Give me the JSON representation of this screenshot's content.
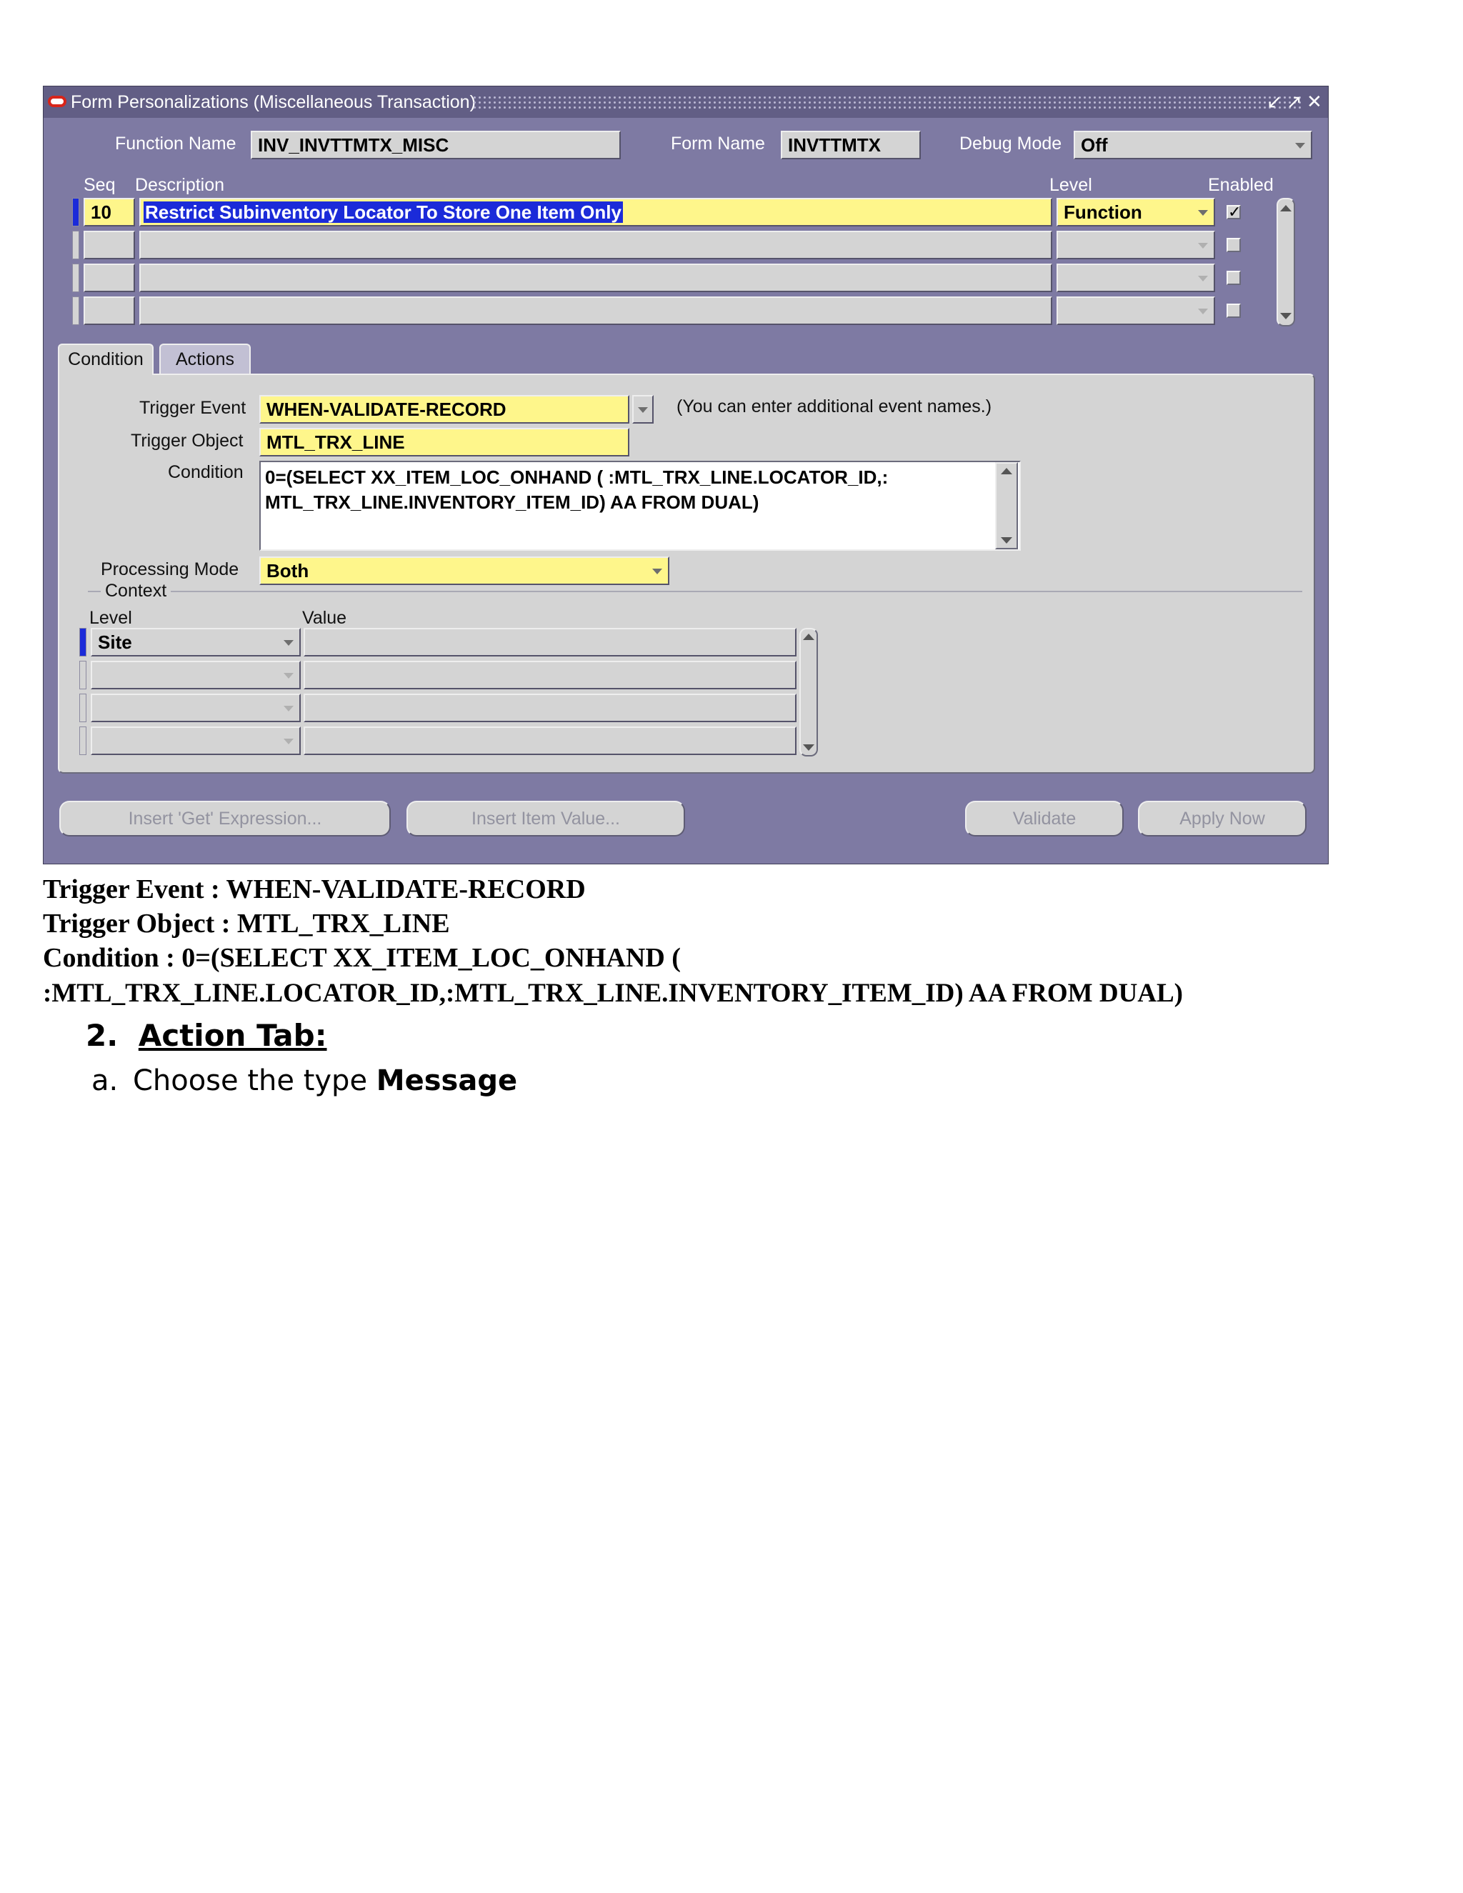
{
  "window": {
    "title": "Form Personalizations (Miscellaneous Transaction)",
    "controls": [
      "↙",
      "↗",
      "✕"
    ]
  },
  "header": {
    "function_name_label": "Function Name",
    "function_name_value": "INV_INVTTMTX_MISC",
    "form_name_label": "Form Name",
    "form_name_value": "INVTTMTX",
    "debug_mode_label": "Debug Mode",
    "debug_mode_value": "Off"
  },
  "rules_grid": {
    "headers": {
      "seq": "Seq",
      "description": "Description",
      "level": "Level",
      "enabled": "Enabled"
    },
    "rows": [
      {
        "seq": "10",
        "description": "Restrict Subinventory Locator To Store One Item Only",
        "level": "Function",
        "enabled": true
      },
      {
        "seq": "",
        "description": "",
        "level": "",
        "enabled": false
      },
      {
        "seq": "",
        "description": "",
        "level": "",
        "enabled": false
      },
      {
        "seq": "",
        "description": "",
        "level": "",
        "enabled": false
      }
    ]
  },
  "tabs": [
    {
      "label": "Condition",
      "active": true
    },
    {
      "label": "Actions",
      "active": false
    }
  ],
  "condition_tab": {
    "trigger_event_label": "Trigger Event",
    "trigger_event_value": "WHEN-VALIDATE-RECORD",
    "trigger_event_hint": "(You can enter additional event names.)",
    "trigger_object_label": "Trigger Object",
    "trigger_object_value": "MTL_TRX_LINE",
    "condition_label": "Condition",
    "condition_line1": "0=(SELECT XX_ITEM_LOC_ONHAND ( :MTL_TRX_LINE.LOCATOR_ID,:",
    "condition_line2": "MTL_TRX_LINE.INVENTORY_ITEM_ID) AA FROM DUAL)",
    "processing_mode_label": "Processing Mode",
    "processing_mode_value": "Both",
    "context_label": "Context",
    "context_headers": {
      "level": "Level",
      "value": "Value"
    },
    "context_rows": [
      {
        "level": "Site",
        "value": ""
      },
      {
        "level": "",
        "value": ""
      },
      {
        "level": "",
        "value": ""
      },
      {
        "level": "",
        "value": ""
      }
    ]
  },
  "buttons": {
    "insert_get_expression": "Insert 'Get' Expression...",
    "insert_item_value": "Insert Item Value...",
    "validate": "Validate",
    "apply_now": "Apply Now"
  },
  "document": {
    "line1": "Trigger Event : WHEN-VALIDATE-RECORD",
    "line2": "Trigger Object  : MTL_TRX_LINE",
    "line3": "Condition  : 0=(SELECT  XX_ITEM_LOC_ONHAND  (",
    "line4": ":MTL_TRX_LINE.LOCATOR_ID,:MTL_TRX_LINE.INVENTORY_ITEM_ID)  AA FROM DUAL)",
    "heading_number": "2.",
    "heading_text": "Action Tab:",
    "item_letter": "a.",
    "item_text": "Choose the type",
    "item_bold": "Message"
  }
}
